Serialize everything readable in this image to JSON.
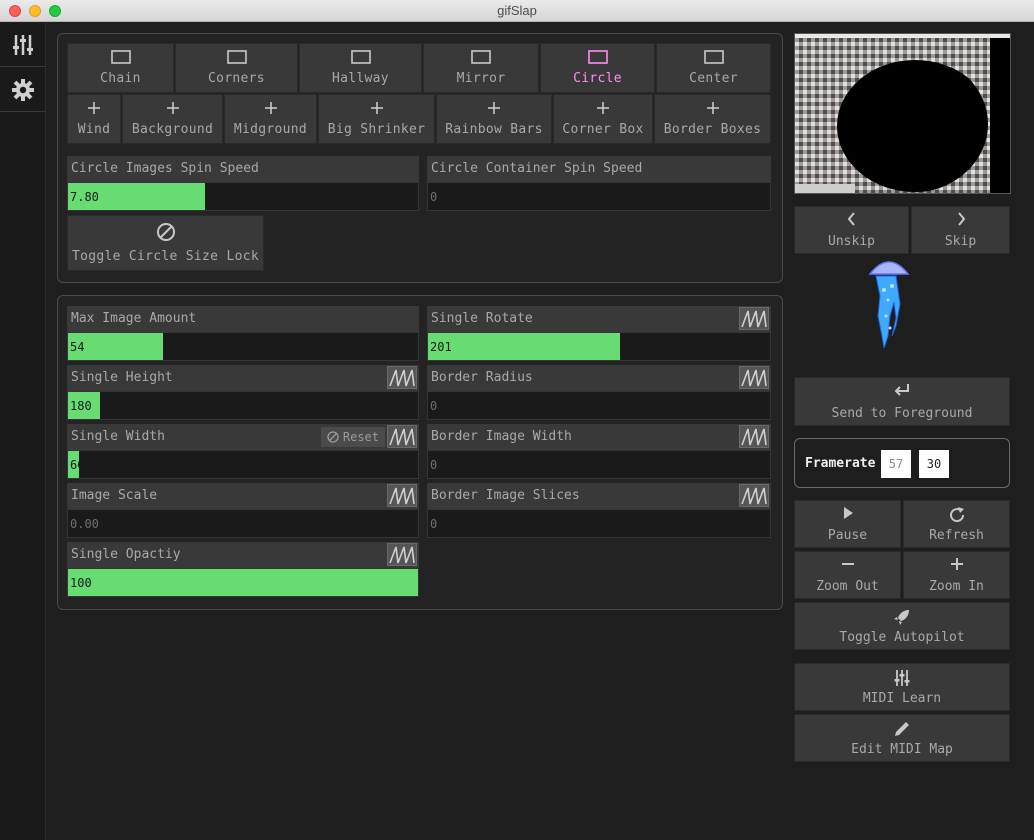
{
  "window": {
    "title": "gifSlap"
  },
  "sidebar": {
    "items": [
      {
        "icon": "sliders-icon"
      },
      {
        "icon": "gear-icon"
      }
    ]
  },
  "modes": [
    {
      "label": "Chain",
      "icon": "rectangle-icon"
    },
    {
      "label": "Corners",
      "icon": "rectangle-icon"
    },
    {
      "label": "Hallway",
      "icon": "rectangle-icon"
    },
    {
      "label": "Mirror",
      "icon": "rectangle-icon"
    },
    {
      "label": "Circle",
      "icon": "rectangle-icon",
      "active": true
    },
    {
      "label": "Center",
      "icon": "rectangle-icon"
    }
  ],
  "layers": [
    {
      "label": "Wind",
      "icon": "plus-icon"
    },
    {
      "label": "Background",
      "icon": "plus-icon"
    },
    {
      "label": "Midground",
      "icon": "plus-icon"
    },
    {
      "label": "Big Shrinker",
      "icon": "plus-icon"
    },
    {
      "label": "Rainbow Bars",
      "icon": "plus-icon"
    },
    {
      "label": "Corner Box",
      "icon": "plus-icon"
    },
    {
      "label": "Border Boxes",
      "icon": "plus-icon"
    }
  ],
  "mode_controls": {
    "circle_images_spin_speed": {
      "label": "Circle Images Spin Speed",
      "value": "7.80",
      "fill": 0.39
    },
    "circle_container_spin_speed": {
      "label": "Circle Container Spin Speed",
      "value": "0",
      "fill": 0
    },
    "toggle_lock": {
      "label": "Toggle Circle Size Lock",
      "icon": "no-entry-icon"
    }
  },
  "params": {
    "max_image_amount": {
      "label": "Max Image Amount",
      "value": "54",
      "fill": 0.27
    },
    "single_rotate": {
      "label": "Single Rotate",
      "value": "201",
      "fill": 0.56
    },
    "single_height": {
      "label": "Single Height",
      "value": "180",
      "fill": 0.09
    },
    "border_radius": {
      "label": "Border Radius",
      "value": "0",
      "fill": 0
    },
    "single_width": {
      "label": "Single Width",
      "value": "60",
      "fill": 0.03,
      "reset_label": "Reset"
    },
    "border_image_width": {
      "label": "Border Image Width",
      "value": "0",
      "fill": 0
    },
    "image_scale": {
      "label": "Image Scale",
      "value": "0.00",
      "fill": 0
    },
    "border_image_slices": {
      "label": "Border Image Slices",
      "value": "0",
      "fill": 0
    },
    "single_opacity": {
      "label": "Single Opactiy",
      "value": "100",
      "fill": 1.0
    }
  },
  "transport": {
    "unskip": "Unskip",
    "skip": "Skip",
    "send_to_foreground": "Send to Foreground",
    "framerate_label": "Framerate",
    "framerate_actual": "57",
    "framerate_target": "30",
    "pause": "Pause",
    "refresh": "Refresh",
    "zoom_out": "Zoom Out",
    "zoom_in": "Zoom In",
    "toggle_autopilot": "Toggle Autopilot",
    "midi_learn": "MIDI Learn",
    "edit_midi_map": "Edit MIDI Map"
  },
  "colors": {
    "accent_fill": "#67dc73",
    "active_mode": "#ff8cf5",
    "button_bg": "#393939"
  }
}
